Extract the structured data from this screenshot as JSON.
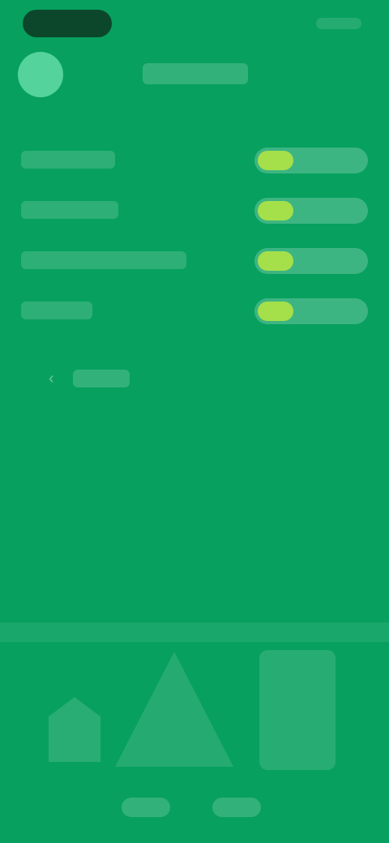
{
  "status_bar": {
    "time": "",
    "right": ""
  },
  "header": {
    "title": ""
  },
  "list": {
    "rows": [
      {
        "label": "",
        "value": ""
      },
      {
        "label": "",
        "value": ""
      },
      {
        "label": "",
        "value": ""
      },
      {
        "label": "",
        "value": ""
      }
    ]
  },
  "back": {
    "label": ""
  },
  "nav": {
    "items": [
      "",
      ""
    ]
  },
  "colors": {
    "background": "#07a05f",
    "accent": "#a5e04a",
    "avatar": "#55d39c"
  },
  "icons": {
    "back": "chevron-left-icon"
  }
}
